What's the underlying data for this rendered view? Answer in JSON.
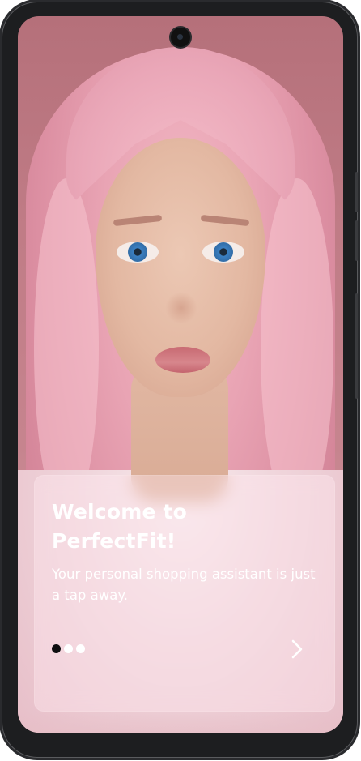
{
  "onboarding": {
    "title": "Welcome to PerfectFit!",
    "subtitle": "Your personal shopping assistant is just a tap away.",
    "pager": {
      "total": 3,
      "active_index": 0
    },
    "next_icon": "chevron-right-icon"
  },
  "colors": {
    "screen_background": "#c07c86",
    "card_tint": "#ffe8ee",
    "text": "#ffffff",
    "active_dot": "#0e0e10",
    "inactive_dot": "#ffffff",
    "device_frame": "#1d1e20"
  }
}
